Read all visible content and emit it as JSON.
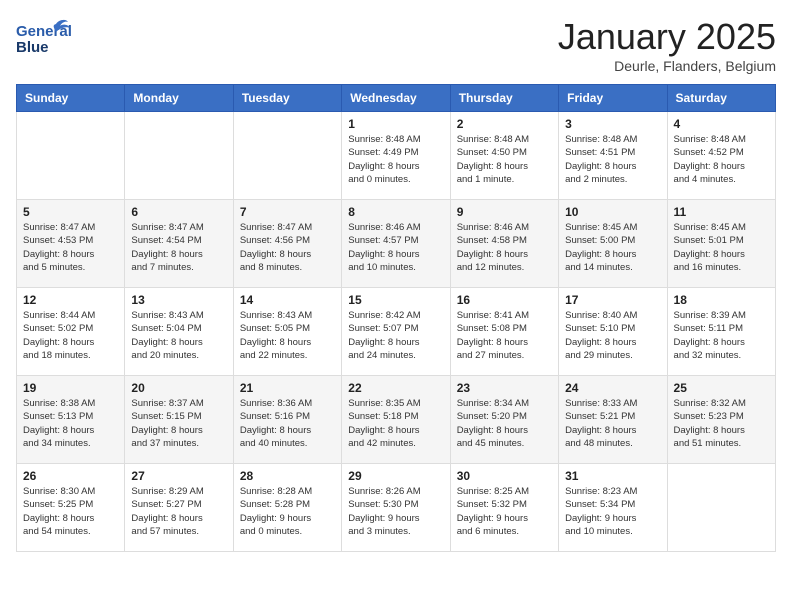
{
  "header": {
    "logo_general": "General",
    "logo_blue": "Blue",
    "month_title": "January 2025",
    "location": "Deurle, Flanders, Belgium"
  },
  "weekdays": [
    "Sunday",
    "Monday",
    "Tuesday",
    "Wednesday",
    "Thursday",
    "Friday",
    "Saturday"
  ],
  "weeks": [
    [
      {
        "day": "",
        "info": ""
      },
      {
        "day": "",
        "info": ""
      },
      {
        "day": "",
        "info": ""
      },
      {
        "day": "1",
        "info": "Sunrise: 8:48 AM\nSunset: 4:49 PM\nDaylight: 8 hours\nand 0 minutes."
      },
      {
        "day": "2",
        "info": "Sunrise: 8:48 AM\nSunset: 4:50 PM\nDaylight: 8 hours\nand 1 minute."
      },
      {
        "day": "3",
        "info": "Sunrise: 8:48 AM\nSunset: 4:51 PM\nDaylight: 8 hours\nand 2 minutes."
      },
      {
        "day": "4",
        "info": "Sunrise: 8:48 AM\nSunset: 4:52 PM\nDaylight: 8 hours\nand 4 minutes."
      }
    ],
    [
      {
        "day": "5",
        "info": "Sunrise: 8:47 AM\nSunset: 4:53 PM\nDaylight: 8 hours\nand 5 minutes."
      },
      {
        "day": "6",
        "info": "Sunrise: 8:47 AM\nSunset: 4:54 PM\nDaylight: 8 hours\nand 7 minutes."
      },
      {
        "day": "7",
        "info": "Sunrise: 8:47 AM\nSunset: 4:56 PM\nDaylight: 8 hours\nand 8 minutes."
      },
      {
        "day": "8",
        "info": "Sunrise: 8:46 AM\nSunset: 4:57 PM\nDaylight: 8 hours\nand 10 minutes."
      },
      {
        "day": "9",
        "info": "Sunrise: 8:46 AM\nSunset: 4:58 PM\nDaylight: 8 hours\nand 12 minutes."
      },
      {
        "day": "10",
        "info": "Sunrise: 8:45 AM\nSunset: 5:00 PM\nDaylight: 8 hours\nand 14 minutes."
      },
      {
        "day": "11",
        "info": "Sunrise: 8:45 AM\nSunset: 5:01 PM\nDaylight: 8 hours\nand 16 minutes."
      }
    ],
    [
      {
        "day": "12",
        "info": "Sunrise: 8:44 AM\nSunset: 5:02 PM\nDaylight: 8 hours\nand 18 minutes."
      },
      {
        "day": "13",
        "info": "Sunrise: 8:43 AM\nSunset: 5:04 PM\nDaylight: 8 hours\nand 20 minutes."
      },
      {
        "day": "14",
        "info": "Sunrise: 8:43 AM\nSunset: 5:05 PM\nDaylight: 8 hours\nand 22 minutes."
      },
      {
        "day": "15",
        "info": "Sunrise: 8:42 AM\nSunset: 5:07 PM\nDaylight: 8 hours\nand 24 minutes."
      },
      {
        "day": "16",
        "info": "Sunrise: 8:41 AM\nSunset: 5:08 PM\nDaylight: 8 hours\nand 27 minutes."
      },
      {
        "day": "17",
        "info": "Sunrise: 8:40 AM\nSunset: 5:10 PM\nDaylight: 8 hours\nand 29 minutes."
      },
      {
        "day": "18",
        "info": "Sunrise: 8:39 AM\nSunset: 5:11 PM\nDaylight: 8 hours\nand 32 minutes."
      }
    ],
    [
      {
        "day": "19",
        "info": "Sunrise: 8:38 AM\nSunset: 5:13 PM\nDaylight: 8 hours\nand 34 minutes."
      },
      {
        "day": "20",
        "info": "Sunrise: 8:37 AM\nSunset: 5:15 PM\nDaylight: 8 hours\nand 37 minutes."
      },
      {
        "day": "21",
        "info": "Sunrise: 8:36 AM\nSunset: 5:16 PM\nDaylight: 8 hours\nand 40 minutes."
      },
      {
        "day": "22",
        "info": "Sunrise: 8:35 AM\nSunset: 5:18 PM\nDaylight: 8 hours\nand 42 minutes."
      },
      {
        "day": "23",
        "info": "Sunrise: 8:34 AM\nSunset: 5:20 PM\nDaylight: 8 hours\nand 45 minutes."
      },
      {
        "day": "24",
        "info": "Sunrise: 8:33 AM\nSunset: 5:21 PM\nDaylight: 8 hours\nand 48 minutes."
      },
      {
        "day": "25",
        "info": "Sunrise: 8:32 AM\nSunset: 5:23 PM\nDaylight: 8 hours\nand 51 minutes."
      }
    ],
    [
      {
        "day": "26",
        "info": "Sunrise: 8:30 AM\nSunset: 5:25 PM\nDaylight: 8 hours\nand 54 minutes."
      },
      {
        "day": "27",
        "info": "Sunrise: 8:29 AM\nSunset: 5:27 PM\nDaylight: 8 hours\nand 57 minutes."
      },
      {
        "day": "28",
        "info": "Sunrise: 8:28 AM\nSunset: 5:28 PM\nDaylight: 9 hours\nand 0 minutes."
      },
      {
        "day": "29",
        "info": "Sunrise: 8:26 AM\nSunset: 5:30 PM\nDaylight: 9 hours\nand 3 minutes."
      },
      {
        "day": "30",
        "info": "Sunrise: 8:25 AM\nSunset: 5:32 PM\nDaylight: 9 hours\nand 6 minutes."
      },
      {
        "day": "31",
        "info": "Sunrise: 8:23 AM\nSunset: 5:34 PM\nDaylight: 9 hours\nand 10 minutes."
      },
      {
        "day": "",
        "info": ""
      }
    ]
  ]
}
